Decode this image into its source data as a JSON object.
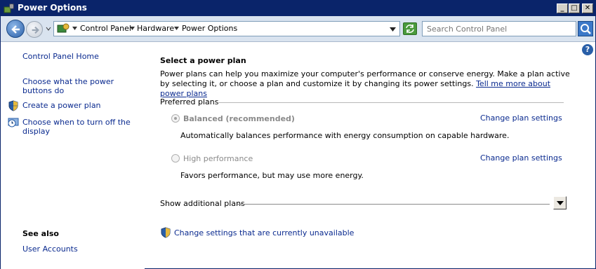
{
  "window": {
    "title": "Power Options",
    "controls": {
      "minimize": "_",
      "maximize": "□",
      "close": "✕"
    }
  },
  "addressbar": {
    "breadcrumbs": [
      "Control Panel",
      "Hardware",
      "Power Options"
    ],
    "search_placeholder": "Search Control Panel"
  },
  "leftpane": {
    "home_link": "Control Panel Home",
    "tasks": [
      {
        "label": "Choose what the power buttons do",
        "icon": "none"
      },
      {
        "label": "Create a power plan",
        "icon": "shield-icon"
      },
      {
        "label": "Choose when to turn off the display",
        "icon": "clock-display-icon"
      }
    ],
    "see_also_title": "See also",
    "see_also_links": [
      "User Accounts"
    ]
  },
  "main": {
    "heading": "Select a power plan",
    "intro": "Power plans can help you maximize your computer's performance or conserve energy. Make a plan active by selecting it, or choose a plan and customize it by changing its power settings.",
    "intro_link": "Tell me more about power plans",
    "preferred_label": "Preferred plans",
    "plans": [
      {
        "name": "Balanced (recommended)",
        "description": "Automatically balances performance with energy consumption on capable hardware.",
        "change_link": "Change plan settings",
        "selected": true
      },
      {
        "name": "High performance",
        "description": "Favors performance, but may use more energy.",
        "change_link": "Change plan settings",
        "selected": false
      }
    ],
    "show_additional": "Show additional plans",
    "unavailable_link": "Change settings that are currently unavailable"
  },
  "help": {
    "glyph": "?"
  },
  "colors": {
    "titlebar": "#0a246a",
    "link": "#0a2a8f",
    "addressbar_bg": "#d9e3ef",
    "disabled_text": "#8a8a8a"
  }
}
